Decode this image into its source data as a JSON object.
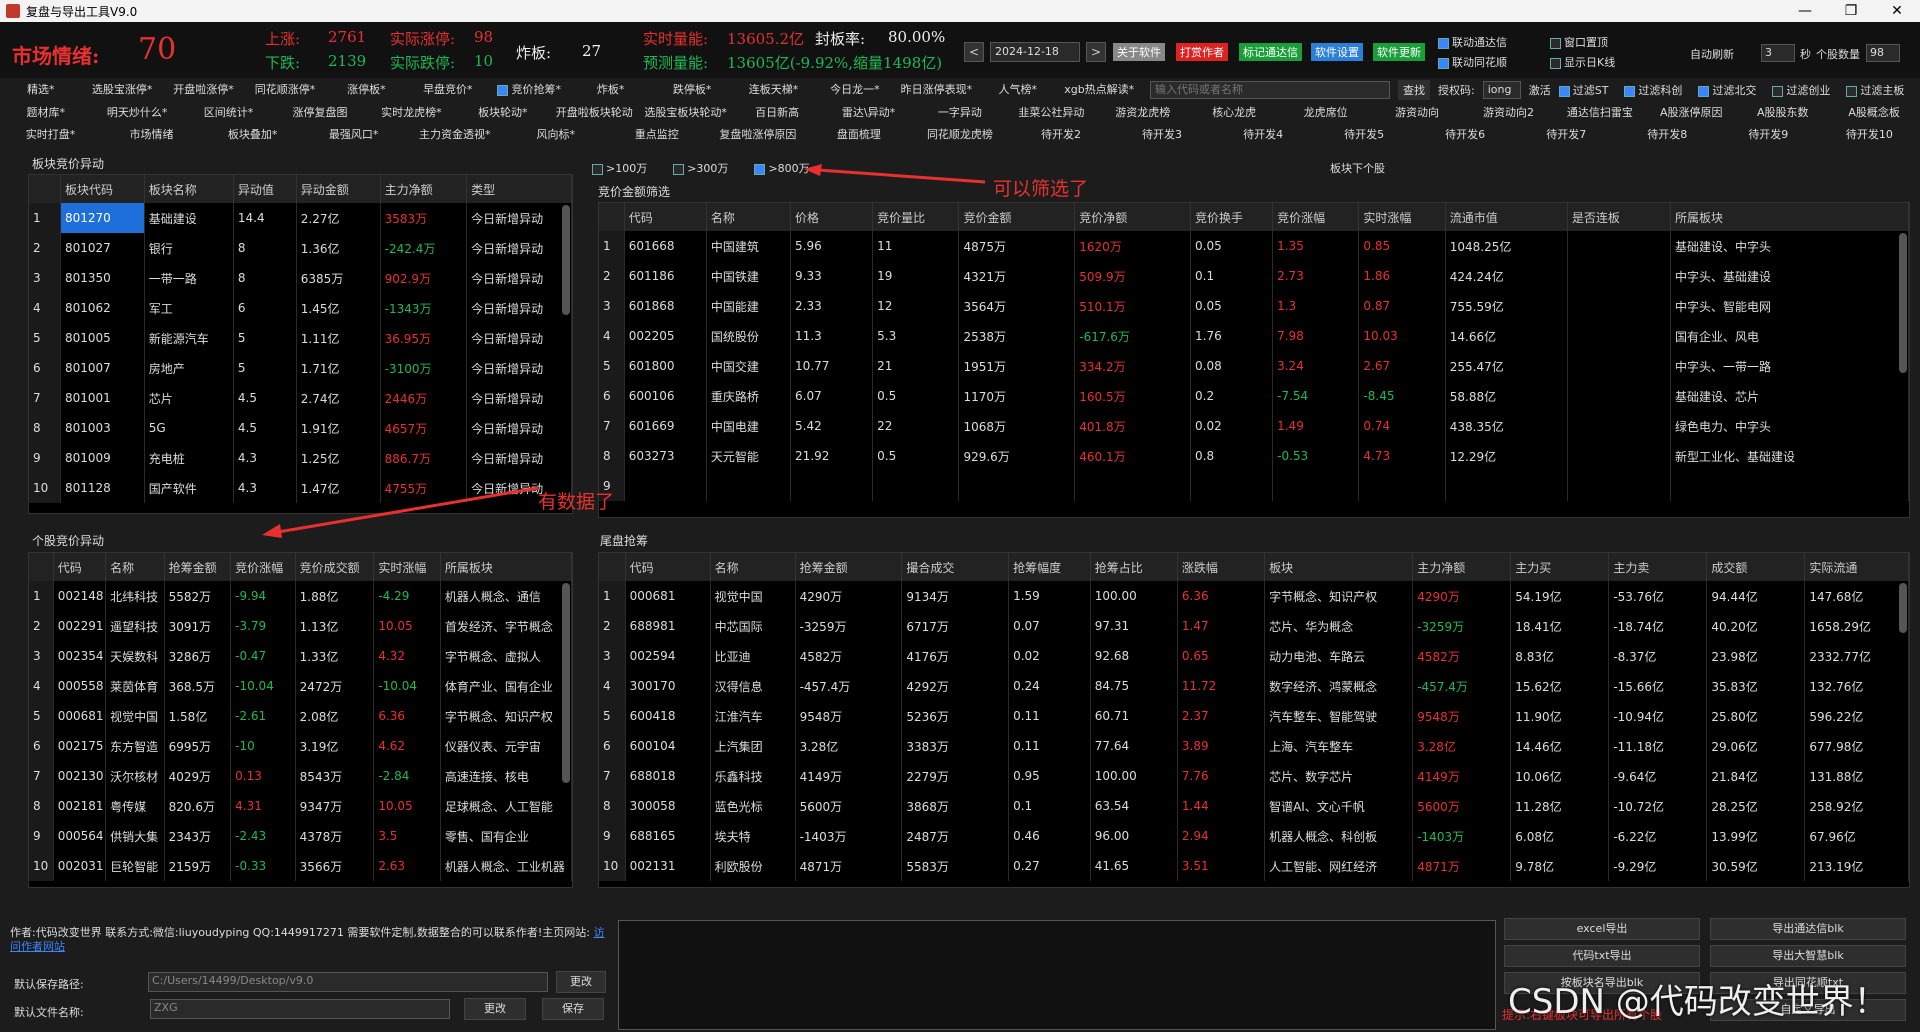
{
  "window": {
    "title": "复盘与导出工具V9.0"
  },
  "top": {
    "mood_label": "市场情绪:",
    "mood_value": "70",
    "up_label": "上涨:",
    "up_val": "2761",
    "limitup_label": "实际涨停:",
    "limitup_val": "98",
    "down_label": "下跌:",
    "down_val": "2139",
    "limitdown_label": "实际跌停:",
    "limitdown_val": "10",
    "broken_label": "炸板:",
    "broken_val": "27",
    "rt_vol_label": "实时量能:",
    "rt_vol_val": "13605.2亿",
    "seal_label": "封板率:",
    "seal_val": "80.00%",
    "pred_label": "预测量能:",
    "pred_val": "13605亿(-9.92%,缩量1498亿)",
    "prev": "<",
    "next": ">",
    "date": "2024-12-18",
    "btn_about": "关于软件",
    "btn_reward": "打赏作者",
    "btn_mark": "标记通达信",
    "btn_settings": "软件设置",
    "btn_update": "软件更新",
    "link_tdx": "联动通达信",
    "link_ths": "联动同花顺",
    "window_top": "窗口置顶",
    "show_k": "显示日K线",
    "auto_refresh": "自动刷新",
    "refresh_val": "3",
    "sec": "秒",
    "stock_count_label": "个股数量",
    "stock_count": "98"
  },
  "menu1": [
    "精选*",
    "选股宝涨停*",
    "开盘啦涨停*",
    "同花顺涨停*",
    "涨停板*",
    "早盘竞价*",
    "竞价抢筹*",
    "炸板*",
    "跌停板*",
    "连板天梯*",
    "今日龙一*",
    "昨日涨停表现*",
    "人气榜*",
    "xgb热点解读*"
  ],
  "menu1_tail": {
    "search_placeholder": "输入代码或者名称",
    "search": "查找",
    "auth_label": "授权码:",
    "auth_val": "iong",
    "activate": "激活",
    "filters": [
      "过滤ST",
      "过滤科创",
      "过滤北交",
      "过滤创业",
      "过滤主板"
    ]
  },
  "menu2": [
    "题材库*",
    "明天炒什么*",
    "区间统计*",
    "涨停复盘图",
    "实时龙虎榜*",
    "板块轮动*",
    "开盘啦板块轮动",
    "选股宝板块轮动*",
    "百日新高",
    "雷达\\异动*",
    "一字异动",
    "韭菜公社异动",
    "游资龙虎榜",
    "核心龙虎",
    "龙虎席位",
    "游资动向",
    "游资动向2",
    "通达信扫雷宝",
    "A股涨停原因",
    "A股股东数",
    "A股概念板"
  ],
  "menu3": [
    "实时打盘*",
    "市场情绪",
    "板块叠加*",
    "最强风口*",
    "主力资金透视*",
    "风向标*",
    "重点监控",
    "复盘啦涨停原因",
    "盘面梳理",
    "同花顺龙虎榜",
    "待开发2",
    "待开发3",
    "待开发4",
    "待开发5",
    "待开发6",
    "待开发7",
    "待开发8",
    "待开发9",
    "待开发10"
  ],
  "sector": {
    "title": "板块竞价异动",
    "cols": [
      "板块代码",
      "板块名称",
      "异动值",
      "异动金额",
      "主力净额",
      "类型"
    ],
    "rows": [
      [
        "801270",
        "基础建设",
        "14.4",
        "2.27亿",
        "3583万",
        "今日新增异动"
      ],
      [
        "801027",
        "银行",
        "8",
        "1.36亿",
        "-242.4万",
        "今日新增异动"
      ],
      [
        "801350",
        "一带一路",
        "8",
        "6385万",
        "902.9万",
        "今日新增异动"
      ],
      [
        "801062",
        "军工",
        "6",
        "1.45亿",
        "-1343万",
        "今日新增异动"
      ],
      [
        "801005",
        "新能源汽车",
        "5",
        "1.11亿",
        "36.95万",
        "今日新增异动"
      ],
      [
        "801007",
        "房地产",
        "5",
        "1.71亿",
        "-3100万",
        "今日新增异动"
      ],
      [
        "801001",
        "芯片",
        "4.5",
        "2.74亿",
        "2446万",
        "今日新增异动"
      ],
      [
        "801003",
        "5G",
        "4.5",
        "1.91亿",
        "4657万",
        "今日新增异动"
      ],
      [
        "801009",
        "充电桩",
        "4.3",
        "1.25亿",
        "886.7万",
        "今日新增异动"
      ],
      [
        "801128",
        "国产软件",
        "4.3",
        "1.47亿",
        "4755万",
        "今日新增异动"
      ]
    ]
  },
  "filter": {
    "opt1": ">100万",
    "opt2": ">300万",
    "opt3": ">800万",
    "sector_stocks": "板块下个股",
    "annotation": "可以筛选了"
  },
  "auction": {
    "title": "竞价金额筛选",
    "cols": [
      "代码",
      "名称",
      "价格",
      "竞价量比",
      "竞价金额",
      "竞价净额",
      "竞价换手",
      "竞价涨幅",
      "实时涨幅",
      "流通市值",
      "是否连板",
      "所属板块"
    ],
    "rows": [
      [
        "601668",
        "中国建筑",
        "5.96",
        "11",
        "4875万",
        "1620万",
        "0.05",
        "1.35",
        "0.85",
        "1048.25亿",
        "",
        "基础建设、中字头"
      ],
      [
        "601186",
        "中国铁建",
        "9.33",
        "19",
        "4321万",
        "509.9万",
        "0.1",
        "2.73",
        "1.86",
        "424.24亿",
        "",
        "中字头、基础建设"
      ],
      [
        "601868",
        "中国能建",
        "2.33",
        "12",
        "3564万",
        "510.1万",
        "0.05",
        "1.3",
        "0.87",
        "755.59亿",
        "",
        "中字头、智能电网"
      ],
      [
        "002205",
        "国统股份",
        "11.3",
        "5.3",
        "2538万",
        "-617.6万",
        "1.76",
        "7.98",
        "10.03",
        "14.66亿",
        "",
        "国有企业、风电"
      ],
      [
        "601800",
        "中国交建",
        "10.77",
        "21",
        "1951万",
        "334.2万",
        "0.08",
        "3.24",
        "2.67",
        "255.47亿",
        "",
        "中字头、一带一路"
      ],
      [
        "600106",
        "重庆路桥",
        "6.07",
        "0.5",
        "1170万",
        "160.5万",
        "0.2",
        "-7.54",
        "-8.45",
        "58.88亿",
        "",
        "基础建设、芯片"
      ],
      [
        "601669",
        "中国电建",
        "5.42",
        "22",
        "1068万",
        "401.8万",
        "0.02",
        "1.49",
        "0.74",
        "438.35亿",
        "",
        "绿色电力、中字头"
      ],
      [
        "603273",
        "天元智能",
        "21.92",
        "0.5",
        "929.6万",
        "460.1万",
        "0.8",
        "-0.53",
        "4.73",
        "12.29亿",
        "",
        "新型工业化、基础建设"
      ]
    ],
    "empty_row_num": "9"
  },
  "individual": {
    "title": "个股竞价异动",
    "annotation": "有数据了",
    "cols": [
      "代码",
      "名称",
      "抢筹金额",
      "竞价涨幅",
      "竞价成交额",
      "实时涨幅",
      "所属板块"
    ],
    "rows": [
      [
        "002148",
        "北纬科技",
        "5582万",
        "-9.94",
        "1.88亿",
        "-4.29",
        "机器人概念、通信"
      ],
      [
        "002291",
        "遥望科技",
        "3091万",
        "-3.79",
        "1.13亿",
        "10.05",
        "首发经济、字节概念"
      ],
      [
        "002354",
        "天娱数科",
        "3286万",
        "-0.47",
        "1.33亿",
        "4.32",
        "字节概念、虚拟人"
      ],
      [
        "000558",
        "莱茵体育",
        "368.5万",
        "-10.04",
        "2472万",
        "-10.04",
        "体育产业、国有企业"
      ],
      [
        "000681",
        "视觉中国",
        "1.58亿",
        "-2.61",
        "2.08亿",
        "6.36",
        "字节概念、知识产权"
      ],
      [
        "002175",
        "东方智造",
        "6995万",
        "-10",
        "3.19亿",
        "4.62",
        "仪器仪表、元宇宙"
      ],
      [
        "002130",
        "沃尔核材",
        "4029万",
        "0.13",
        "8543万",
        "-2.84",
        "高速连接、核电"
      ],
      [
        "002181",
        "粤传媒",
        "820.6万",
        "4.31",
        "9347万",
        "10.05",
        "足球概念、人工智能"
      ],
      [
        "000564",
        "供销大集",
        "2343万",
        "-2.43",
        "4378万",
        "3.5",
        "零售、国有企业"
      ],
      [
        "002031",
        "巨轮智能",
        "2159万",
        "-0.33",
        "3566万",
        "2.63",
        "机器人概念、工业机器"
      ]
    ]
  },
  "tail": {
    "title": "尾盘抢筹",
    "cols": [
      "代码",
      "名称",
      "抢筹金额",
      "撮合成交",
      "抢筹幅度",
      "抢筹占比",
      "涨跌幅",
      "板块",
      "主力净额",
      "主力买",
      "主力卖",
      "成交额",
      "实际流通"
    ],
    "rows": [
      [
        "000681",
        "视觉中国",
        "4290万",
        "9134万",
        "1.59",
        "100.00",
        "6.36",
        "字节概念、知识产权",
        "4290万",
        "54.19亿",
        "-53.76亿",
        "94.44亿",
        "147.68亿"
      ],
      [
        "688981",
        "中芯国际",
        "-3259万",
        "6717万",
        "0.07",
        "97.31",
        "1.47",
        "芯片、华为概念",
        "-3259万",
        "18.41亿",
        "-18.74亿",
        "40.20亿",
        "1658.29亿"
      ],
      [
        "002594",
        "比亚迪",
        "4582万",
        "4176万",
        "0.02",
        "92.68",
        "0.65",
        "动力电池、车路云",
        "4582万",
        "8.83亿",
        "-8.37亿",
        "23.98亿",
        "2332.77亿"
      ],
      [
        "300170",
        "汉得信息",
        "-457.4万",
        "4292万",
        "0.24",
        "84.75",
        "11.72",
        "数字经济、鸿蒙概念",
        "-457.4万",
        "15.62亿",
        "-15.66亿",
        "35.83亿",
        "132.76亿"
      ],
      [
        "600418",
        "江淮汽车",
        "9548万",
        "5236万",
        "0.11",
        "60.71",
        "2.37",
        "汽车整车、智能驾驶",
        "9548万",
        "11.90亿",
        "-10.94亿",
        "25.80亿",
        "596.22亿"
      ],
      [
        "600104",
        "上汽集团",
        "3.28亿",
        "3383万",
        "0.11",
        "77.64",
        "3.89",
        "上海、汽车整车",
        "3.28亿",
        "14.46亿",
        "-11.18亿",
        "29.06亿",
        "677.98亿"
      ],
      [
        "688018",
        "乐鑫科技",
        "4149万",
        "2279万",
        "0.95",
        "100.00",
        "7.76",
        "芯片、数字芯片",
        "4149万",
        "10.06亿",
        "-9.64亿",
        "21.84亿",
        "131.88亿"
      ],
      [
        "300058",
        "蓝色光标",
        "5600万",
        "3868万",
        "0.1",
        "63.54",
        "1.44",
        "智谱AI、文心千帆",
        "5600万",
        "11.28亿",
        "-10.72亿",
        "28.25亿",
        "258.92亿"
      ],
      [
        "688165",
        "埃夫特",
        "-1403万",
        "2487万",
        "0.46",
        "96.00",
        "2.94",
        "机器人概念、科创板",
        "-1403万",
        "6.08亿",
        "-6.22亿",
        "13.99亿",
        "67.96亿"
      ],
      [
        "002131",
        "利欧股份",
        "4871万",
        "5583万",
        "0.27",
        "41.65",
        "3.51",
        "人工智能、网红经济",
        "4871万",
        "9.78亿",
        "-9.29亿",
        "30.59亿",
        "213.19亿"
      ]
    ]
  },
  "bottom": {
    "author": "作者:代码改变世界 联系方式:微信:liuyoudyping QQ:1449917271 需要软件定制,数据整合的可以联系作者!主页网站:",
    "link": "访问作者网站",
    "save_path_label": "默认保存路径:",
    "save_path": "C:/Users/14499/Desktop/v9.0",
    "change": "更改",
    "file_label": "默认文件名称:",
    "file_name": "ZXG",
    "save": "保存",
    "export_btns": [
      "excel导出",
      "导出通达信blk",
      "代码txt导出",
      "导出大智慧blk",
      "按板块名导出blk",
      "导出同花顺txt",
      "",
      "自定义导出"
    ],
    "tip": "提示:右键板块可导出所有个股",
    "watermark": "CSDN @代码改变世界！"
  },
  "colors": {
    "red": "#e83030",
    "green": "#1db954",
    "accent": "#1e6fd9"
  }
}
